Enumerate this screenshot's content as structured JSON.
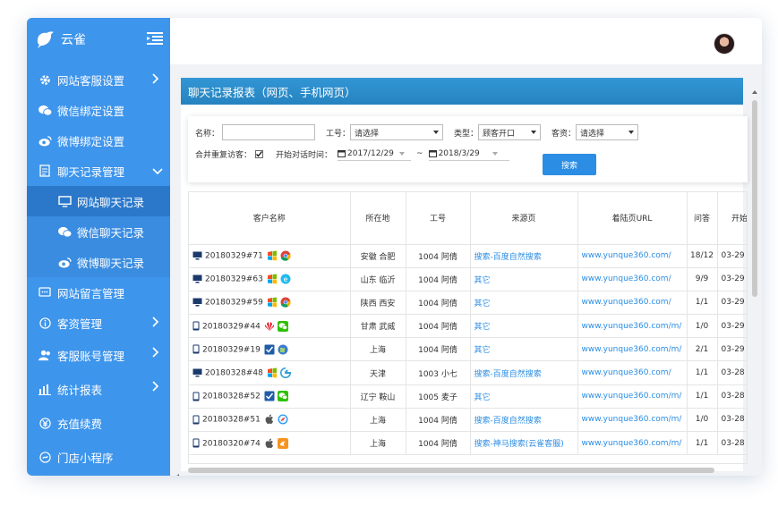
{
  "brand": {
    "title": "云雀"
  },
  "nav": [
    {
      "label": "网站客服设置",
      "icon": "gear-icon",
      "arrow": "right"
    },
    {
      "label": "微信绑定设置",
      "icon": "wechat-icon",
      "arrow": ""
    },
    {
      "label": "微博绑定设置",
      "icon": "weibo-icon",
      "arrow": ""
    },
    {
      "label": "聊天记录管理",
      "icon": "document-icon",
      "arrow": "down"
    }
  ],
  "subnav": [
    {
      "label": "网站聊天记录",
      "icon": "monitor-icon",
      "current": true
    },
    {
      "label": "微信聊天记录",
      "icon": "wechat-icon",
      "current": false
    },
    {
      "label": "微博聊天记录",
      "icon": "weibo-icon",
      "current": false
    }
  ],
  "nav2": [
    {
      "label": "网站留言管理",
      "icon": "message-icon",
      "arrow": ""
    },
    {
      "label": "客资管理",
      "icon": "info-icon",
      "arrow": "right"
    },
    {
      "label": "客服账号管理",
      "icon": "users-icon",
      "arrow": "right"
    },
    {
      "label": "统计报表",
      "icon": "bar-chart-icon",
      "arrow": "right"
    },
    {
      "label": "充值续费",
      "icon": "yen-icon",
      "arrow": ""
    },
    {
      "label": "门店小程序",
      "icon": "mini-program-icon",
      "arrow": ""
    }
  ],
  "panel": {
    "title": "聊天记录报表（网页、手机网页）"
  },
  "filters": {
    "name_label": "名称：",
    "worker_label": "工号：",
    "worker_value": "请选择",
    "type_label": "类型：",
    "type_value": "顾客开口",
    "lead_label": "客资：",
    "lead_value": "请选择",
    "merge_label": "合并重复访客：",
    "time_label": "开始对话时间：",
    "date_from": "2017/12/29",
    "tilde": "~",
    "date_to": "2018/3/29",
    "search_label": "搜索"
  },
  "table": {
    "headers": [
      "客户名称",
      "所在地",
      "工号",
      "来源页",
      "着陆页URL",
      "问答",
      "开始"
    ],
    "rows": [
      {
        "device": "pc",
        "name": "20180329#71",
        "os": "windows",
        "browser": "chrome",
        "loc": "安徽 合肥",
        "worker": "1004 阿倩",
        "source": "搜索-百度自然搜索",
        "url": "www.yunque360.com/",
        "qa": "18/12",
        "start": "03-29"
      },
      {
        "device": "pc",
        "name": "20180329#63",
        "os": "windows",
        "browser": "ie",
        "loc": "山东 临沂",
        "worker": "1004 阿倩",
        "source": "其它",
        "url": "www.yunque360.com/",
        "qa": "9/9",
        "start": "03-29"
      },
      {
        "device": "pc",
        "name": "20180329#59",
        "os": "windows",
        "browser": "chrome",
        "loc": "陕西 西安",
        "worker": "1004 阿倩",
        "source": "其它",
        "url": "www.yunque360.com/",
        "qa": "1/1",
        "start": "03-29"
      },
      {
        "device": "mobile",
        "name": "20180329#44",
        "os": "huawei",
        "browser": "wechat",
        "loc": "甘肃 武威",
        "worker": "1004 阿倩",
        "source": "其它",
        "url": "www.yunque360.com/m/",
        "qa": "1/0",
        "start": "03-29"
      },
      {
        "device": "mobile",
        "name": "20180329#19",
        "os": "check",
        "browser": "globe",
        "loc": "上海",
        "worker": "1004 阿倩",
        "source": "其它",
        "url": "www.yunque360.com/m/",
        "qa": "2/1",
        "start": "03-29"
      },
      {
        "device": "pc",
        "name": "20180328#48",
        "os": "windows",
        "browser": "edge",
        "loc": "天津",
        "worker": "1003 小七",
        "source": "搜索-百度自然搜索",
        "url": "www.yunque360.com/",
        "qa": "1/1",
        "start": "03-28"
      },
      {
        "device": "mobile",
        "name": "20180328#52",
        "os": "check",
        "browser": "wechat",
        "loc": "辽宁 鞍山",
        "worker": "1005 麦子",
        "source": "其它",
        "url": "www.yunque360.com/m/",
        "qa": "1/1",
        "start": "03-28"
      },
      {
        "device": "mobile",
        "name": "20180328#51",
        "os": "apple",
        "browser": "safari",
        "loc": "上海",
        "worker": "1004 阿倩",
        "source": "搜索-百度自然搜索",
        "url": "www.yunque360.com/m/",
        "qa": "1/0",
        "start": "03-28"
      },
      {
        "device": "mobile",
        "name": "20180320#74",
        "os": "apple",
        "browser": "uc",
        "loc": "上海",
        "worker": "1004 阿倩",
        "source": "搜索-神马搜索(云雀客服)",
        "url": "www.yunque360.com/m/",
        "qa": "1/1",
        "start": "03-28"
      }
    ]
  }
}
